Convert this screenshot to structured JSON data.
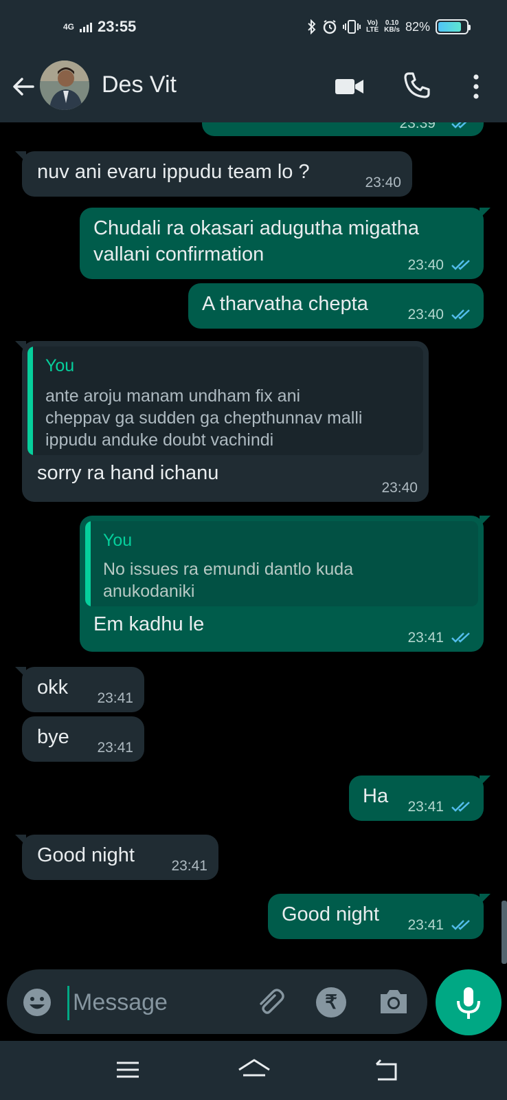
{
  "status_bar": {
    "network": "4G",
    "time": "23:55",
    "volte_line1": "Vo)",
    "volte_line2": "LTE",
    "speed_value": "0.10",
    "speed_unit": "KB/s",
    "battery_percent": "82%",
    "battery_level": 0.82
  },
  "header": {
    "contact_name": "Des Vit"
  },
  "messages": [
    {
      "direction": "out",
      "text": "",
      "time": "23:39",
      "status": "read"
    },
    {
      "direction": "in",
      "text": "nuv ani evaru ippudu team lo ?",
      "time": "23:40"
    },
    {
      "direction": "out",
      "lines": [
        "Chudali ra okasari adugutha migatha",
        "vallani confirmation"
      ],
      "time": "23:40",
      "status": "read"
    },
    {
      "direction": "out",
      "text": "A tharvatha chepta",
      "time": "23:40",
      "status": "read"
    },
    {
      "direction": "in",
      "quote_author": "You",
      "quote_lines": [
        "ante aroju manam undham fix ani",
        "cheppav ga sudden ga chepthunnav malli",
        "ippudu anduke doubt vachindi"
      ],
      "text": "sorry ra hand ichanu",
      "time": "23:40"
    },
    {
      "direction": "out",
      "quote_author": "You",
      "quote_lines": [
        "No issues ra emundi dantlo kuda",
        "anukodaniki"
      ],
      "text": "Em kadhu le",
      "time": "23:41",
      "status": "read"
    },
    {
      "direction": "in",
      "text": "okk",
      "time": "23:41"
    },
    {
      "direction": "in",
      "text": "bye",
      "time": "23:41"
    },
    {
      "direction": "out",
      "text": "Ha",
      "time": "23:41",
      "status": "read"
    },
    {
      "direction": "in",
      "text": "Good night",
      "time": "23:41"
    },
    {
      "direction": "out",
      "text": "Good night",
      "time": "23:41",
      "status": "read"
    }
  ],
  "input": {
    "placeholder": "Message",
    "value": ""
  },
  "icons": {
    "back": "arrow-left-icon",
    "video": "video-camera-icon",
    "call": "phone-icon",
    "more": "more-vertical-icon",
    "emoji": "emoji-icon",
    "attach": "paperclip-icon",
    "payment": "rupee-icon",
    "camera": "camera-icon",
    "mic": "microphone-icon"
  },
  "payment_symbol": "₹",
  "colors": {
    "header_bg": "#1f2c34",
    "chat_bg": "#000000",
    "incoming_bubble": "#202c33",
    "outgoing_bubble": "#005c4b",
    "accent": "#00a884",
    "read_ticks": "#53bdeb"
  }
}
